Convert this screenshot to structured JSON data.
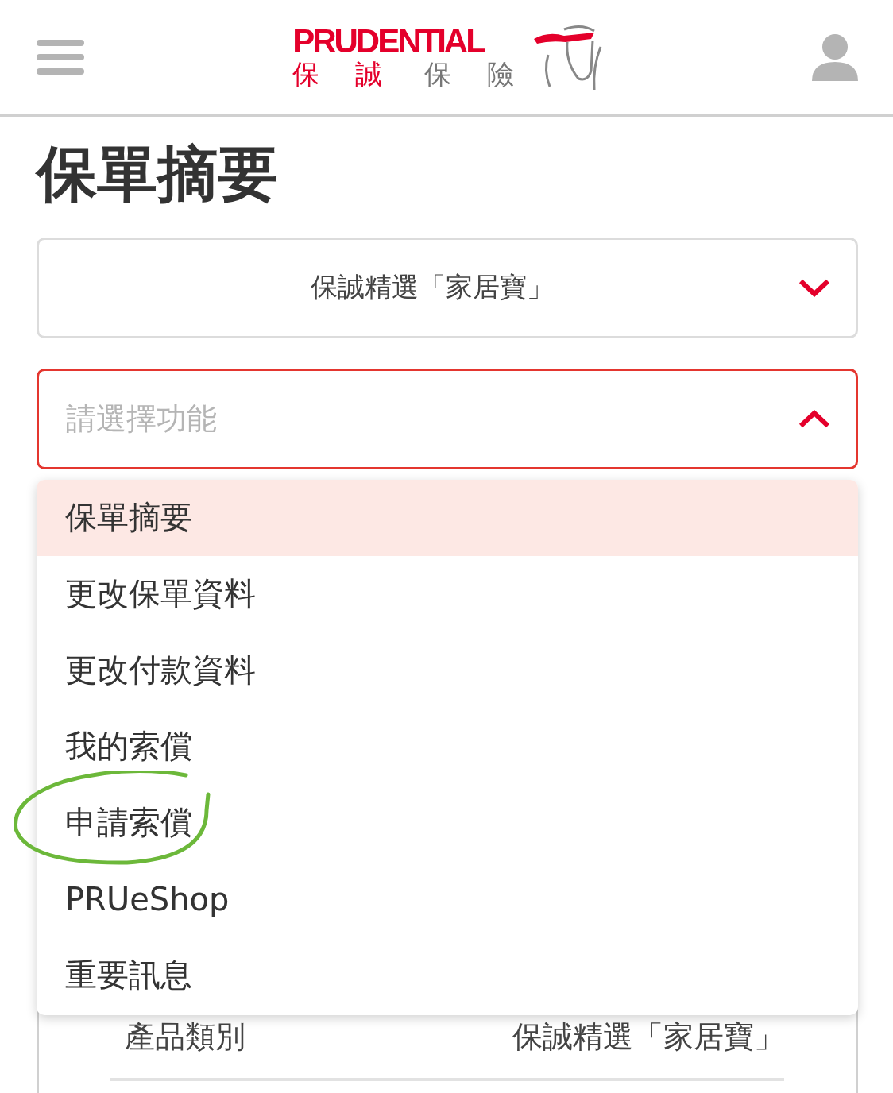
{
  "header": {
    "brand": "PRUDENTIAL",
    "tagline_red": "保 誠",
    "tagline_grey": "保 險"
  },
  "page_title": "保單摘要",
  "policy_select": {
    "value": "保誠精選「家居寶」",
    "expanded": false
  },
  "function_select": {
    "placeholder": "請選擇功能",
    "expanded": true
  },
  "menu_items": [
    {
      "label": "保單摘要",
      "selected": true,
      "circled": false
    },
    {
      "label": "更改保單資料",
      "selected": false,
      "circled": false
    },
    {
      "label": "更改付款資料",
      "selected": false,
      "circled": false
    },
    {
      "label": "我的索償",
      "selected": false,
      "circled": false
    },
    {
      "label": "申請索償",
      "selected": false,
      "circled": true
    },
    {
      "label": "PRUeShop",
      "selected": false,
      "circled": false
    },
    {
      "label": "重要訊息",
      "selected": false,
      "circled": false
    }
  ],
  "summary_rows": [
    {
      "label": "產品類別",
      "value": "保誠精選「家居寶」"
    }
  ]
}
